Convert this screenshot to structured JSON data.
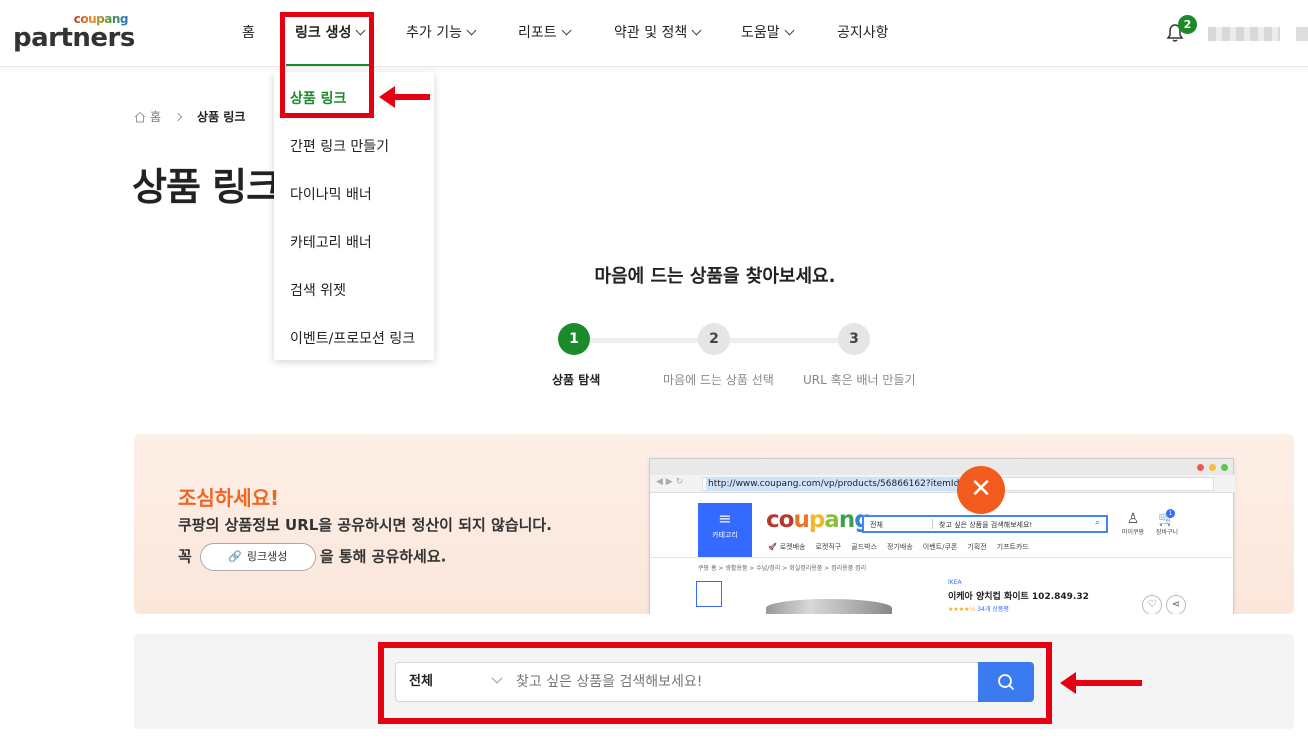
{
  "brand": {
    "small": "coupang",
    "big": "partners"
  },
  "nav": {
    "items": [
      {
        "label": "홈",
        "has_menu": false
      },
      {
        "label": "링크 생성",
        "has_menu": true,
        "active": true
      },
      {
        "label": "추가 기능",
        "has_menu": true
      },
      {
        "label": "리포트",
        "has_menu": true
      },
      {
        "label": "약관 및 정책",
        "has_menu": true
      },
      {
        "label": "도움말",
        "has_menu": true
      },
      {
        "label": "공지사항",
        "has_menu": false
      }
    ],
    "notification_count": "2"
  },
  "dropdown": {
    "items": [
      {
        "label": "상품 링크",
        "active": true
      },
      {
        "label": "간편 링크 만들기"
      },
      {
        "label": "다이나믹 배너"
      },
      {
        "label": "카테고리 배너"
      },
      {
        "label": "검색 위젯"
      },
      {
        "label": "이벤트/프로모션 링크"
      }
    ]
  },
  "breadcrumb": {
    "home": "홈",
    "current": "상품 링크"
  },
  "page": {
    "title": "상품 링크"
  },
  "steps": {
    "heading": "마음에 드는 상품을 찾아보세요.",
    "items": [
      {
        "number": "1",
        "label": "상품 탐색",
        "active": true
      },
      {
        "number": "2",
        "label": "마음에 드는 상품 선택"
      },
      {
        "number": "3",
        "label": "URL 혹은 배너 만들기"
      }
    ]
  },
  "warning": {
    "title": "조심하세요!",
    "line1": "쿠팡의 상품정보 URL을 공유하시면 정산이 되지 않습니다.",
    "line2_prefix": "꼭",
    "pill_label": "링크생성",
    "line2_suffix": "을 통해 공유하세요.",
    "browser": {
      "url": "http://www.coupang.com/vp/products/56866162?itemId",
      "category_label": "카테고리",
      "logo": "coupang",
      "search_select": "전체",
      "search_placeholder": "찾고 싶은 상품을 검색해보세요!",
      "nav_items": [
        "로켓배송",
        "로켓직구",
        "골드박스",
        "정기배송",
        "이벤트/쿠폰",
        "기획전",
        "기프트카드"
      ],
      "breadcrumb": "쿠팡 홈 > 생활용품 > 수납/정리 > 회실정리용품 > 정리용품 정리",
      "product_brand": "IKEA",
      "product_name": "이케아 양치컵 화이트 102.849.32",
      "rating_stars": "★★★★½",
      "rating_count": "34개 상품평",
      "my_label": "마이쿠팡",
      "cart_label": "장바구니",
      "cart_count": "1"
    }
  },
  "search": {
    "category": "전체",
    "placeholder": "찾고 싶은 상품을 검색해보세요!"
  },
  "colors": {
    "accent_green": "#1c8a2b",
    "highlight_red": "#e60012",
    "warning_orange": "#f06522",
    "search_blue": "#3a7bf0"
  }
}
